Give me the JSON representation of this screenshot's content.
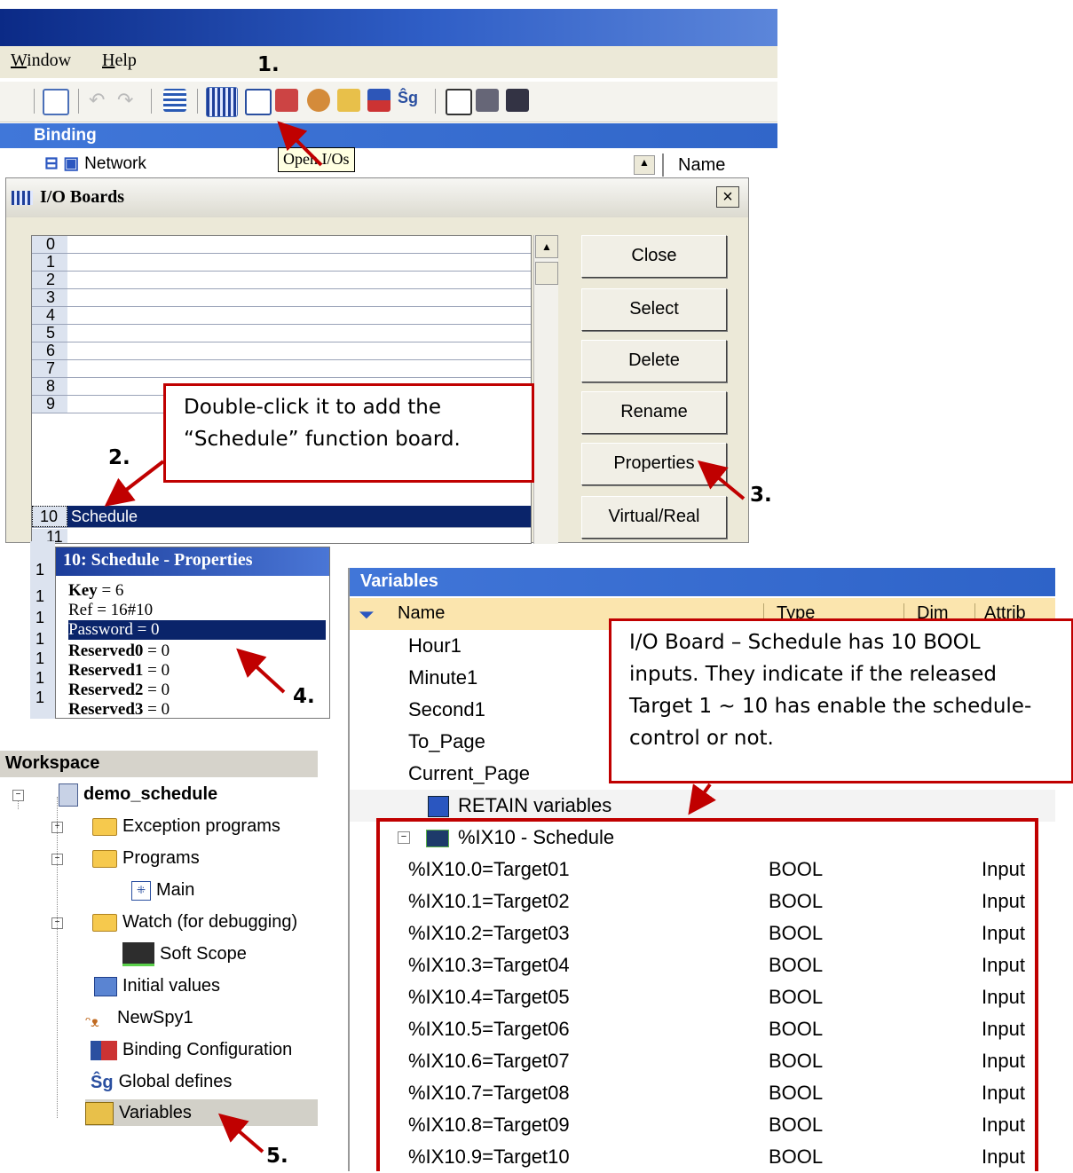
{
  "menu": {
    "window": "Window",
    "help": "Help"
  },
  "binding": {
    "title": "Binding",
    "network": "Network",
    "name_col": "Name"
  },
  "tooltip": "Open I/Os",
  "io_dialog": {
    "title": "I/O Boards",
    "close_x": "×",
    "rows": [
      {
        "num": "0",
        "label": ""
      },
      {
        "num": "1",
        "label": ""
      },
      {
        "num": "2",
        "label": ""
      },
      {
        "num": "3",
        "label": ""
      },
      {
        "num": "4",
        "label": ""
      },
      {
        "num": "5",
        "label": ""
      },
      {
        "num": "6",
        "label": ""
      },
      {
        "num": "7",
        "label": ""
      },
      {
        "num": "8",
        "label": ""
      },
      {
        "num": "9",
        "label": ""
      },
      {
        "num": "10",
        "label": "Schedule"
      },
      {
        "num": "11",
        "label": ""
      }
    ],
    "buttons": [
      "Close",
      "Select",
      "Delete",
      "Rename",
      "Properties",
      "Virtual/Real"
    ]
  },
  "properties": {
    "title": "10: Schedule - Properties",
    "items": [
      {
        "key": "Key",
        "value": "= 6"
      },
      {
        "key": "Ref",
        "value": "= 16#10"
      },
      {
        "key": "Password",
        "value": "= 0"
      },
      {
        "key": "Reserved0",
        "value": "= 0"
      },
      {
        "key": "Reserved1",
        "value": "= 0"
      },
      {
        "key": "Reserved2",
        "value": "= 0"
      },
      {
        "key": "Reserved3",
        "value": "= 0"
      }
    ],
    "left_numbers": [
      "1",
      "1",
      "1",
      "1",
      "1",
      "1",
      "1"
    ]
  },
  "workspace": {
    "title": "Workspace",
    "project": "demo_schedule",
    "items": {
      "exception": "Exception programs",
      "programs": "Programs",
      "main": "Main",
      "watch": "Watch (for debugging)",
      "scope": "Soft Scope",
      "initial": "Initial values",
      "spy": "NewSpy1",
      "bindcfg": "Binding Configuration",
      "globals": "Global defines",
      "variables": "Variables"
    }
  },
  "variables": {
    "title": "Variables",
    "columns": {
      "name": "Name",
      "type": "Type",
      "dim": "Dim",
      "attrib": "Attrib"
    },
    "plain": [
      "Hour1",
      "Minute1",
      "Second1",
      "To_Page",
      "Current_Page"
    ],
    "retain": "RETAIN variables",
    "group": "%IX10 - Schedule",
    "rows": [
      {
        "name": "%IX10.0=Target01",
        "type": "BOOL",
        "attrib": "Input"
      },
      {
        "name": "%IX10.1=Target02",
        "type": "BOOL",
        "attrib": "Input"
      },
      {
        "name": "%IX10.2=Target03",
        "type": "BOOL",
        "attrib": "Input"
      },
      {
        "name": "%IX10.3=Target04",
        "type": "BOOL",
        "attrib": "Input"
      },
      {
        "name": "%IX10.4=Target05",
        "type": "BOOL",
        "attrib": "Input"
      },
      {
        "name": "%IX10.5=Target06",
        "type": "BOOL",
        "attrib": "Input"
      },
      {
        "name": "%IX10.6=Target07",
        "type": "BOOL",
        "attrib": "Input"
      },
      {
        "name": "%IX10.7=Target08",
        "type": "BOOL",
        "attrib": "Input"
      },
      {
        "name": "%IX10.8=Target09",
        "type": "BOOL",
        "attrib": "Input"
      },
      {
        "name": "%IX10.9=Target10",
        "type": "BOOL",
        "attrib": "Input"
      }
    ]
  },
  "annotations": {
    "note1": "Double-click it to add the “Schedule” function board.",
    "note2": "I/O Board – Schedule has 10 BOOL inputs. They indicate if the released Target 1 ~ 10 has enable the schedule-control or not.",
    "steps": [
      "1.",
      "2.",
      "3.",
      "4.",
      "5."
    ]
  },
  "colors": {
    "annotation_red": "#c00000",
    "selection": "#0a246a",
    "header_blue": "#3166c9"
  }
}
